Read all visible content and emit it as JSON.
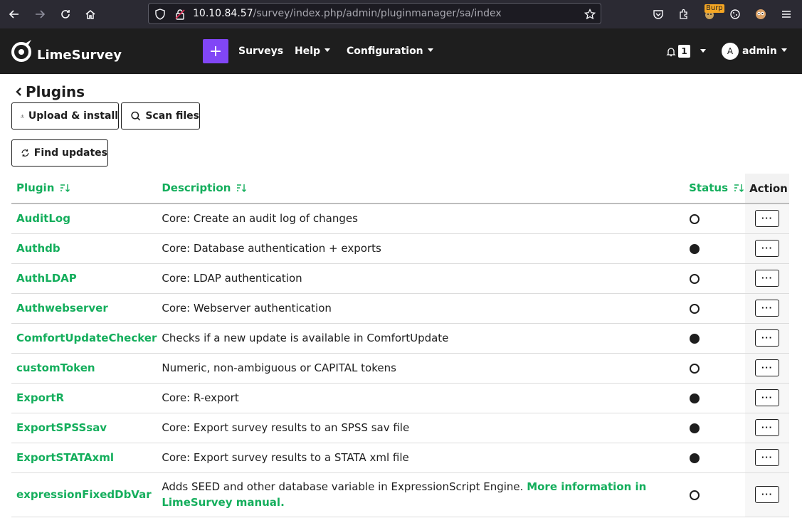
{
  "browser": {
    "url_host": "10.10.84.57",
    "url_path": "/survey/index.php/admin/pluginmanager/sa/index",
    "burp_label": "Burp"
  },
  "nav": {
    "brand": "LimeSurvey",
    "plus_label": "+",
    "surveys": "Surveys",
    "help": "Help",
    "configuration": "Configuration",
    "notification_count": "1",
    "avatar_initial": "A",
    "user": "admin"
  },
  "page": {
    "title": "Plugins",
    "upload_label": "Upload & install",
    "scan_label": "Scan files",
    "find_updates_label": "Find updates"
  },
  "table": {
    "headers": {
      "plugin": "Plugin",
      "description": "Description",
      "status": "Status",
      "action": "Action"
    },
    "action_label": "···",
    "rows": [
      {
        "name": "AuditLog",
        "description": "Core: Create an audit log of changes",
        "active": false
      },
      {
        "name": "Authdb",
        "description": "Core: Database authentication + exports",
        "active": true
      },
      {
        "name": "AuthLDAP",
        "description": "Core: LDAP authentication",
        "active": false
      },
      {
        "name": "Authwebserver",
        "description": "Core: Webserver authentication",
        "active": false
      },
      {
        "name": "ComfortUpdateChecker",
        "description": "Checks if a new update is available in ComfortUpdate",
        "active": true
      },
      {
        "name": "customToken",
        "description": "Numeric, non-ambiguous or CAPITAL tokens",
        "active": false
      },
      {
        "name": "ExportR",
        "description": "Core: R-export",
        "active": true
      },
      {
        "name": "ExportSPSSsav",
        "description": "Core: Export survey results to an SPSS sav file",
        "active": true
      },
      {
        "name": "ExportSTATAxml",
        "description": "Core: Export survey results to a STATA xml file",
        "active": true
      },
      {
        "name": "expressionFixedDbVar",
        "description": "Adds SEED and other database variable in ExpressionScript Engine.",
        "link": "More information in LimeSurvey manual.",
        "active": false
      }
    ]
  },
  "colors": {
    "brand_green": "#14ae5c",
    "plus_purple": "#8146f6",
    "nav_bg": "#1e1e1e"
  }
}
